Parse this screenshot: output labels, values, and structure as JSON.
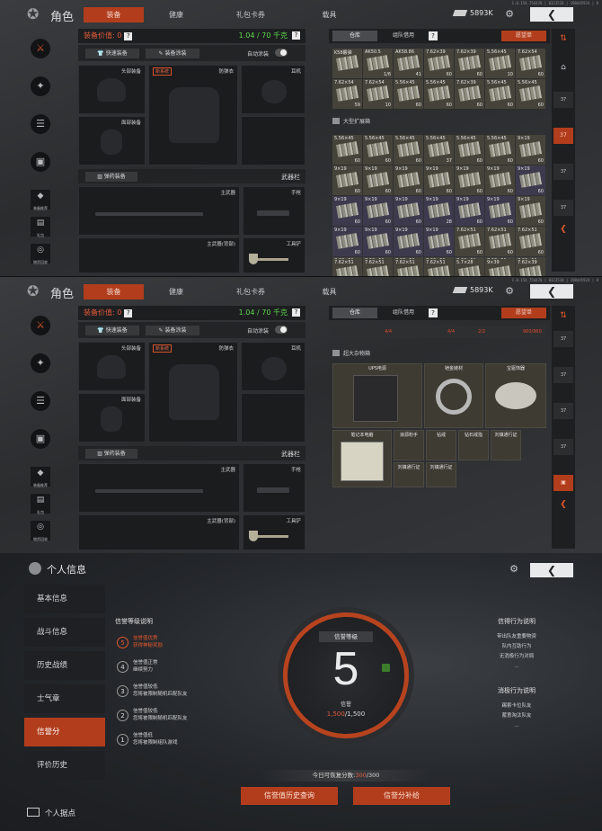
{
  "version_text": "1.0.154.754470 | 0323510 | 198445924 | 0",
  "top": {
    "title": "角色",
    "tabs": [
      "装备",
      "健康",
      "礼包卡券",
      "载具"
    ],
    "money": "5893K",
    "back_icon": "chevron-left-icon",
    "user_icon": "user-settings-icon"
  },
  "left_nav": {
    "items": [
      {
        "icon": "character-icon"
      },
      {
        "icon": "skills-icon"
      },
      {
        "icon": "tasks-icon"
      },
      {
        "icon": "vehicle-icon"
      },
      {
        "icon": "recommend-icon",
        "label": "装备推荐"
      },
      {
        "icon": "gift-icon",
        "label": "礼包"
      },
      {
        "icon": "recycle-icon",
        "label": "物资回收"
      }
    ]
  },
  "equipment": {
    "value_label": "装备价值: 0",
    "weight": "1.04 / 70 千克",
    "quick_equip": "快速装备",
    "quick_paint": "装备涂装",
    "auto_paint": "自动涂装",
    "slots": {
      "head": "头部装备",
      "new_tag": "新系统",
      "armor": "防弹衣",
      "ear": "耳机",
      "face": "面部装备",
      "ammo_btn": "弹药装备",
      "weapons": "武器栏",
      "main": "主武器",
      "pistol": "手枪",
      "main_back": "主武器(背部)",
      "tool": "工具铲"
    }
  },
  "inventory": {
    "tabs": [
      "仓库",
      "组队借用"
    ],
    "wish": "愿望单",
    "expand_label": "大型扩展箱",
    "row1": [
      {
        "n": "K58霰弹",
        "c": ""
      },
      {
        "n": "AK50.5",
        "c": "1/6"
      },
      {
        "n": "AK58.86",
        "c": "41"
      },
      {
        "n": "7.62×39",
        "c": "60"
      },
      {
        "n": "7.62×39",
        "c": "60"
      },
      {
        "n": "5.56×45",
        "c": "10"
      },
      {
        "n": "7.62×54",
        "c": "60"
      }
    ],
    "row2": [
      {
        "n": "7.62×54",
        "c": "59"
      },
      {
        "n": "7.62×54",
        "c": "10"
      },
      {
        "n": "5.56×45",
        "c": "60"
      },
      {
        "n": "5.56×45",
        "c": "60"
      },
      {
        "n": "7.62×39",
        "c": "60"
      },
      {
        "n": "5.56×45",
        "c": "60"
      },
      {
        "n": "5.56×45",
        "c": "60"
      }
    ],
    "grid2": [
      {
        "n": "5.56×45",
        "c": "60"
      },
      {
        "n": "5.56×45",
        "c": "60"
      },
      {
        "n": "5.56×45",
        "c": "60"
      },
      {
        "n": "5.56×45",
        "c": "37"
      },
      {
        "n": "5.56×45",
        "c": "60"
      },
      {
        "n": "5.56×45",
        "c": "60"
      },
      {
        "n": "9×19",
        "c": "60"
      },
      {
        "n": "9×19",
        "c": "60"
      },
      {
        "n": "9×19",
        "c": "60"
      },
      {
        "n": "9×19",
        "c": "60"
      },
      {
        "n": "9×19",
        "c": "60"
      },
      {
        "n": "9×19",
        "c": "60"
      },
      {
        "n": "9×19",
        "c": "60"
      },
      {
        "n": "9×19",
        "c": "60"
      },
      {
        "n": "9×19",
        "c": "60"
      },
      {
        "n": "9×19",
        "c": "60"
      },
      {
        "n": "9×19",
        "c": "60"
      },
      {
        "n": "9×19",
        "c": "28"
      },
      {
        "n": "9×19",
        "c": "60"
      },
      {
        "n": "9×19",
        "c": "60"
      },
      {
        "n": "9×19",
        "c": "60"
      },
      {
        "n": "9×19",
        "c": "60"
      },
      {
        "n": "9×19",
        "c": "60"
      },
      {
        "n": "9×19",
        "c": "60"
      },
      {
        "n": "9×19",
        "c": "60"
      },
      {
        "n": "7.62×51",
        "c": "60"
      },
      {
        "n": "7.62×51",
        "c": "60"
      },
      {
        "n": "7.62×51",
        "c": "60"
      },
      {
        "n": "7.62×51",
        "c": "60"
      },
      {
        "n": "7.62×51",
        "c": "60"
      },
      {
        "n": "7.62×51",
        "c": "60"
      },
      {
        "n": "7.62×51",
        "c": "60"
      },
      {
        "n": "7.62×51",
        "c": "60"
      },
      {
        "n": "7.62×51",
        "c": "60"
      },
      {
        "n": "7.62×51",
        "c": "60"
      }
    ],
    "partial": [
      {
        "n": "7.62×51",
        "c": ""
      },
      {
        "n": "7.62×51",
        "c": ""
      },
      {
        "n": "7.62×51",
        "c": ""
      },
      {
        "n": "7.62×51",
        "c": ""
      },
      {
        "n": "5.7×28",
        "c": ""
      },
      {
        "n": "9×39",
        "c": ""
      },
      {
        "n": "7.62×39",
        "c": ""
      }
    ],
    "counts_p2": [
      "4/4",
      "4/4",
      "2/2",
      "960/960"
    ],
    "big_box_label": "超大杂物箱",
    "items": [
      {
        "n": "UPS电源"
      },
      {
        "n": "铠金链材"
      },
      {
        "n": "宝驱饰器"
      },
      {
        "n": "笔记本电脑"
      },
      {
        "n": "浪源粉手"
      },
      {
        "n": "钻戒"
      },
      {
        "n": "钻石戒指"
      },
      {
        "n": "刘镇通行证"
      },
      {
        "n": "刘镇通行证"
      },
      {
        "n": "刘镇通行证"
      }
    ]
  },
  "right_bar": {
    "sort_icon": "sort-icon",
    "home_icon": "home-icon",
    "tags": [
      "37",
      "37",
      "37",
      "37"
    ],
    "collapse_icon": "chevron-left-icon"
  },
  "personal": {
    "title": "个人信息",
    "menu": [
      "基本信息",
      "战斗信息",
      "历史战绩",
      "士气章",
      "信誉分",
      "评价历史"
    ],
    "footer": "个人据点",
    "level_title": "信誉等级说明",
    "levels": [
      {
        "num": "5",
        "a": "信誉值优秀",
        "b": "获得神秘奖励"
      },
      {
        "num": "4",
        "a": "信誉值正常",
        "b": "继续努力"
      },
      {
        "num": "3",
        "a": "信誉值较低",
        "b": "您将被限制随机匹配队友"
      },
      {
        "num": "2",
        "a": "信誉值较低",
        "b": "您将被限制随机匹配队友"
      },
      {
        "num": "1",
        "a": "信誉值低",
        "b": "您将被限制组队游戏"
      }
    ],
    "ring_label": "信誉等级",
    "ring_value": "5",
    "ring_sub": "信誉",
    "score_cur": "1,500",
    "score_max": "/1,500",
    "rules_title": "信得行为说明",
    "rules": [
      "带出队友重要物资",
      "队内互助行为",
      "无消极行为对局",
      "..."
    ],
    "neg_title": "消极行为说明",
    "neg": [
      "踢索卡位队友",
      "蓄意淘汰队友",
      "..."
    ],
    "restore_pre": "今日可恢复分数:",
    "restore_val": "300",
    "restore_max": "/300",
    "btn_history": "信誉值历史查询",
    "btn_supplement": "信誉分补给"
  },
  "colors": {
    "accent": "#b23d1c",
    "weight_green": "#5ed94d",
    "money": "#e6e6e6"
  }
}
